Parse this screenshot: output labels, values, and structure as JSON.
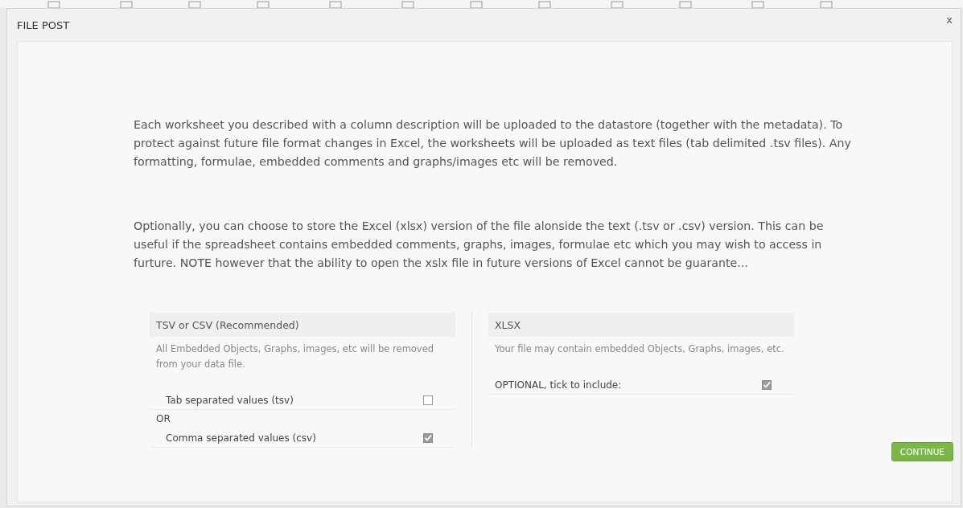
{
  "dialog": {
    "title": "FILE POST",
    "close": "x"
  },
  "paragraphs": [
    "Each worksheet you described with a column description will be uploaded to the datastore (together with the metadata). To protect against future file format changes in Excel, the worksheets will be uploaded as text files (tab delimited .tsv files). Any formatting, formulae, embedded comments and graphs/images etc will be removed.",
    "Optionally, you can choose to store the Excel (xlsx) version of the file alonside the text (.tsv or .csv) version. This can be useful if the spreadsheet contains embedded comments, graphs, images, formulae etc which you may wish to access in furture. NOTE however that the ability to open the xslx file in future versions of Excel cannot be guarante..."
  ],
  "panels": [
    {
      "heading": "TSV or CSV (Recommended)",
      "note": "All Embedded Objects, Graphs, images, etc will be removed from your data file.",
      "items": [
        {
          "kind": "option",
          "label": "Tab separated values (tsv)",
          "checked": false
        },
        {
          "kind": "separator",
          "label": "OR"
        },
        {
          "kind": "option",
          "label": "Comma separated values (csv)",
          "checked": true
        }
      ]
    },
    {
      "heading": "XLSX",
      "note": "Your file may contain embedded Objects, Graphs, images, etc.",
      "items": [
        {
          "kind": "option",
          "label": "OPTIONAL, tick to include:",
          "checked": true
        }
      ]
    }
  ],
  "continue_button": "CONTINUE"
}
